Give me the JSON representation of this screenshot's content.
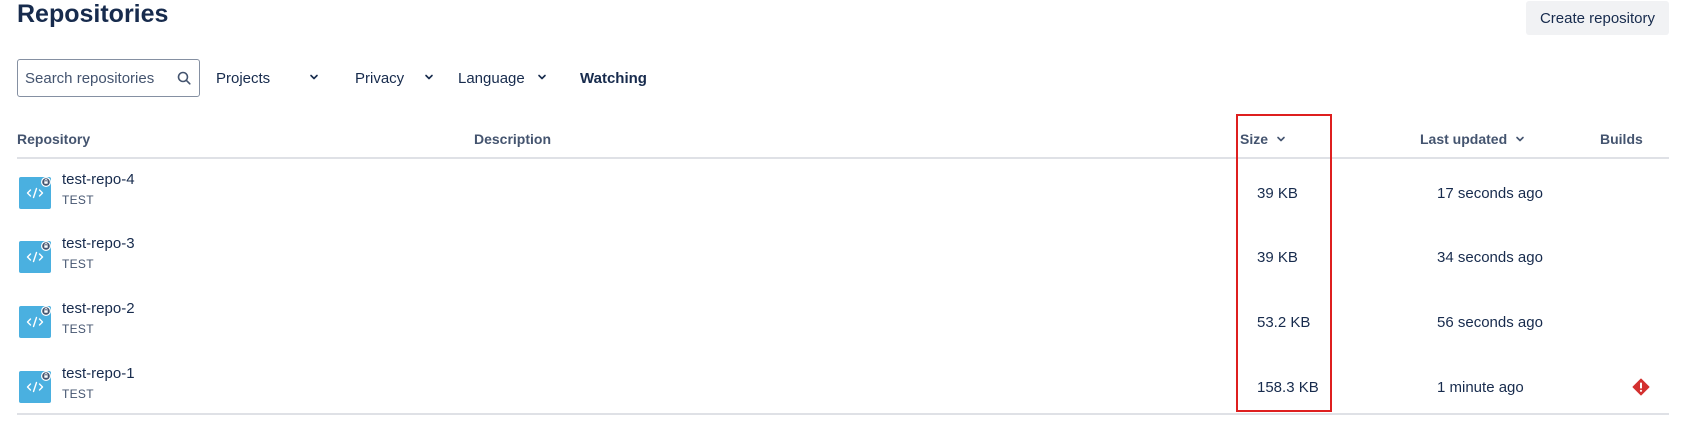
{
  "header": {
    "title": "Repositories",
    "create_label": "Create repository"
  },
  "filters": {
    "search_placeholder": "Search repositories",
    "projects": "Projects",
    "privacy": "Privacy",
    "language": "Language",
    "watching": "Watching"
  },
  "table": {
    "columns": {
      "repository": "Repository",
      "description": "Description",
      "size": "Size",
      "last_updated": "Last updated",
      "builds": "Builds"
    },
    "rows": [
      {
        "name": "test-repo-4",
        "project": "TEST",
        "description": "",
        "size": "39 KB",
        "last_updated": "17 seconds ago",
        "build_status": "none"
      },
      {
        "name": "test-repo-3",
        "project": "TEST",
        "description": "",
        "size": "39 KB",
        "last_updated": "34 seconds ago",
        "build_status": "none"
      },
      {
        "name": "test-repo-2",
        "project": "TEST",
        "description": "",
        "size": "53.2 KB",
        "last_updated": "56 seconds ago",
        "build_status": "none"
      },
      {
        "name": "test-repo-1",
        "project": "TEST",
        "description": "",
        "size": "158.3 KB",
        "last_updated": "1 minute ago",
        "build_status": "failed"
      }
    ]
  },
  "icons": {
    "repo": "code-icon",
    "private_badge": "lock-icon",
    "search": "search-icon",
    "sort": "chevron-down-icon",
    "build_failed": "error-diamond-icon"
  },
  "colors": {
    "accent": "#4ab0e0",
    "text": "#172b4d",
    "subtle_text": "#44546f",
    "error": "#d3302f",
    "highlight": "#de1f1f"
  }
}
